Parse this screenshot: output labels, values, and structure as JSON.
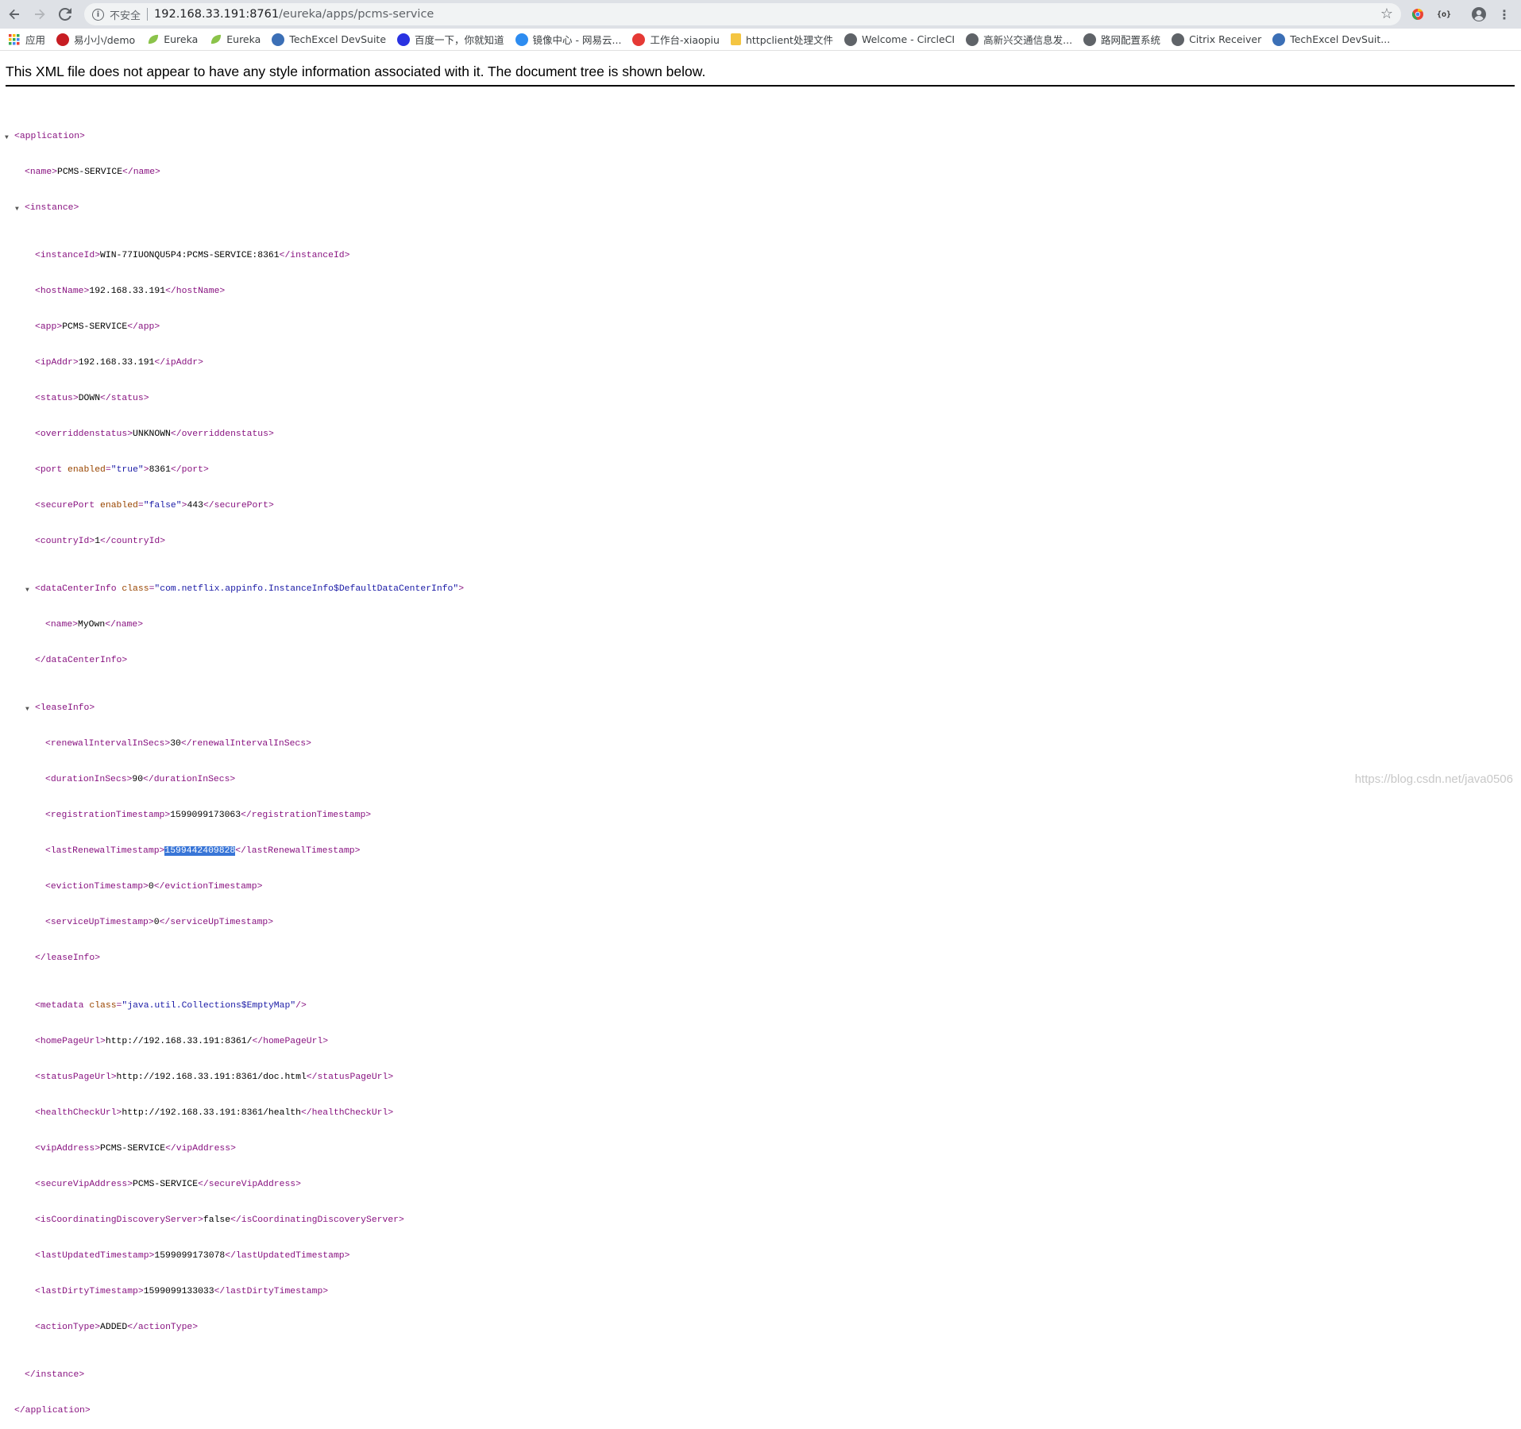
{
  "browser": {
    "security_label": "不安全",
    "url_host": "192.168.33.191:8761",
    "url_path": "/eureka/apps/pcms-service"
  },
  "bookmarks": [
    {
      "label": "应用",
      "icon": "apps-grid-icon",
      "color": "#4285f4"
    },
    {
      "label": "易小小/demo",
      "icon": "gitee-icon",
      "color": "#c71d23"
    },
    {
      "label": "Eureka",
      "icon": "leaf-icon",
      "color": "#8bc34a"
    },
    {
      "label": "Eureka",
      "icon": "leaf-icon",
      "color": "#8bc34a"
    },
    {
      "label": "TechExcel DevSuite",
      "icon": "techexcel-icon",
      "color": "#3b6fb6"
    },
    {
      "label": "百度一下，你就知道",
      "icon": "baidu-paw-icon",
      "color": "#2932e1"
    },
    {
      "label": "镜像中心 - 网易云...",
      "icon": "netease-cloud-icon",
      "color": "#2d8cf0"
    },
    {
      "label": "工作台-xiaopiu",
      "icon": "xiaopiu-icon",
      "color": "#e53935"
    },
    {
      "label": "httpclient处理文件",
      "icon": "folder-icon",
      "color": "#f4c542"
    },
    {
      "label": "Welcome - CircleCI",
      "icon": "globe-icon",
      "color": "#5f6368"
    },
    {
      "label": "高新兴交通信息发...",
      "icon": "globe-icon",
      "color": "#5f6368"
    },
    {
      "label": "路网配置系统",
      "icon": "globe-icon",
      "color": "#5f6368"
    },
    {
      "label": "Citrix Receiver",
      "icon": "citrix-icon",
      "color": "#5f6368"
    },
    {
      "label": "TechExcel DevSuit...",
      "icon": "techexcel-icon",
      "color": "#3b6fb6"
    }
  ],
  "notice": "This XML file does not appear to have any style information associated with it. The document tree is shown below.",
  "xml": {
    "name": "PCMS-SERVICE",
    "instanceId": "WIN-77IUONQU5P4:PCMS-SERVICE:8361",
    "hostName": "192.168.33.191",
    "app": "PCMS-SERVICE",
    "ipAddr": "192.168.33.191",
    "status": "DOWN",
    "overriddenstatus": "UNKNOWN",
    "port_enabled": "true",
    "port": "8361",
    "securePort_enabled": "false",
    "securePort": "443",
    "countryId": "1",
    "dataCenterInfo_class": "com.netflix.appinfo.InstanceInfo$DefaultDataCenterInfo",
    "dataCenterName": "MyOwn",
    "renewalIntervalInSecs": "30",
    "durationInSecs": "90",
    "registrationTimestamp": "1599099173063",
    "lastRenewalTimestamp": "1599442409828",
    "evictionTimestamp": "0",
    "serviceUpTimestamp": "0",
    "metadata_class": "java.util.Collections$EmptyMap",
    "homePageUrl": "http://192.168.33.191:8361/",
    "statusPageUrl": "http://192.168.33.191:8361/doc.html",
    "healthCheckUrl": "http://192.168.33.191:8361/health",
    "vipAddress": "PCMS-SERVICE",
    "secureVipAddress": "PCMS-SERVICE",
    "isCoordinatingDiscoveryServer": "false",
    "lastUpdatedTimestamp": "1599099173078",
    "lastDirtyTimestamp": "1599099133033",
    "actionType": "ADDED"
  },
  "watermark": "https://blog.csdn.net/java0506"
}
